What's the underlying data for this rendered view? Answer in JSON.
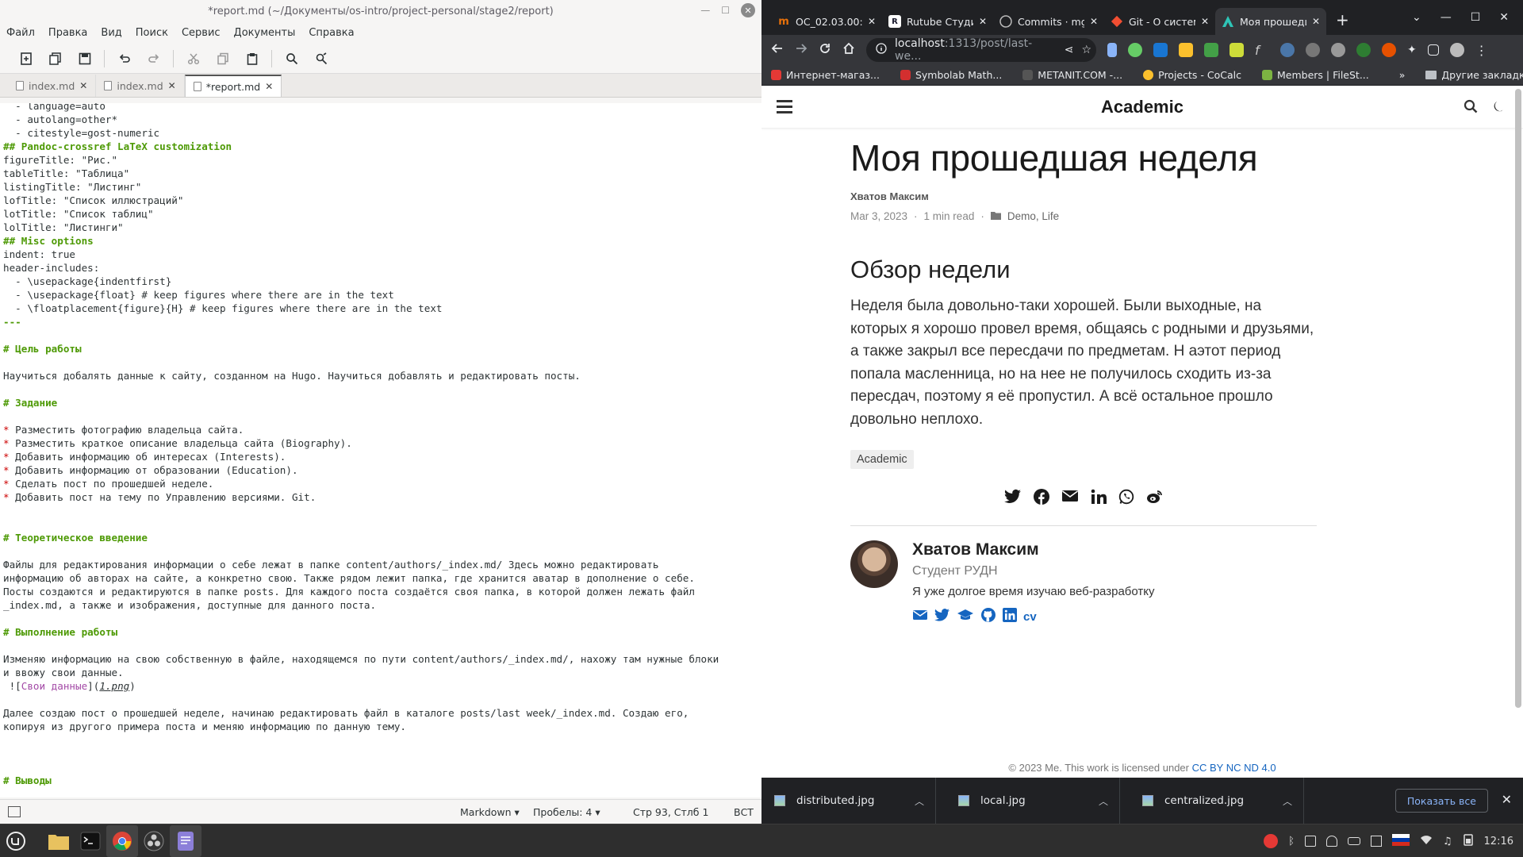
{
  "gedit": {
    "title": "*report.md (~/Документы/os-intro/project-personal/stage2/report)",
    "menu": [
      "Файл",
      "Правка",
      "Вид",
      "Поиск",
      "Сервис",
      "Документы",
      "Справка"
    ],
    "tabs": [
      {
        "label": "index.md",
        "active": false
      },
      {
        "label": "index.md",
        "active": false
      },
      {
        "label": "*report.md",
        "active": true
      }
    ],
    "status": {
      "language": "Markdown",
      "spaces": "Пробелы: 4",
      "position": "Стр 93, Стлб 1",
      "mode": "ВСТ"
    },
    "lines": [
      [
        {
          "t": "  - language=auto"
        }
      ],
      [
        {
          "t": "  - autolang=other*"
        }
      ],
      [
        {
          "t": "  - citestyle=gost-numeric"
        }
      ],
      [
        {
          "t": "## Pandoc-crossref LaTeX customization",
          "c": "c-h"
        }
      ],
      [
        {
          "t": "figureTitle: \"Рис.\""
        }
      ],
      [
        {
          "t": "tableTitle: \"Таблица\""
        }
      ],
      [
        {
          "t": "listingTitle: \"Листинг\""
        }
      ],
      [
        {
          "t": "lofTitle: \"Список иллюстраций\""
        }
      ],
      [
        {
          "t": "lotTitle: \"Список таблиц\""
        }
      ],
      [
        {
          "t": "lolTitle: \"Листинги\""
        }
      ],
      [
        {
          "t": "## Misc options",
          "c": "c-h"
        }
      ],
      [
        {
          "t": "indent: true"
        }
      ],
      [
        {
          "t": "header-includes:"
        }
      ],
      [
        {
          "t": "  - \\usepackage{indentfirst}"
        }
      ],
      [
        {
          "t": "  - \\usepackage{float} # keep figures where there are in the text"
        }
      ],
      [
        {
          "t": "  - \\floatplacement{figure}{H} # keep figures where there are in the text"
        }
      ],
      [
        {
          "t": "---",
          "c": "c-h"
        }
      ],
      [
        {
          "t": ""
        }
      ],
      [
        {
          "t": "# Цель работы",
          "c": "c-h"
        }
      ],
      [
        {
          "t": ""
        }
      ],
      [
        {
          "t": "Научиться добалять данные к сайту, созданном на Hugo. Научиться добавлять и редактировать посты."
        }
      ],
      [
        {
          "t": ""
        }
      ],
      [
        {
          "t": "# Задание",
          "c": "c-h"
        }
      ],
      [
        {
          "t": ""
        }
      ],
      [
        {
          "t": "*",
          "c": "c-b"
        },
        {
          "t": " Разместить фотографию владельца сайта."
        }
      ],
      [
        {
          "t": "*",
          "c": "c-b"
        },
        {
          "t": " Разместить краткое описание владельца сайта (Biography)."
        }
      ],
      [
        {
          "t": "*",
          "c": "c-b"
        },
        {
          "t": " Добавить информацию об интересах (Interests)."
        }
      ],
      [
        {
          "t": "*",
          "c": "c-b"
        },
        {
          "t": " Добавить информацию от образовании (Education)."
        }
      ],
      [
        {
          "t": "*",
          "c": "c-b"
        },
        {
          "t": " Сделать пост по прошедшей неделе."
        }
      ],
      [
        {
          "t": "*",
          "c": "c-b"
        },
        {
          "t": " Добавить пост на тему по Управлению версиями. Git."
        }
      ],
      [
        {
          "t": ""
        }
      ],
      [
        {
          "t": ""
        }
      ],
      [
        {
          "t": "# Теоретическое введение",
          "c": "c-h"
        }
      ],
      [
        {
          "t": ""
        }
      ],
      [
        {
          "t": "Файлы для редактирования информации о себе лежат в папке content/authors/_index.md/ Здесь можно редактировать"
        }
      ],
      [
        {
          "t": "информацию об авторах на сайте, а конкретно свою. Также рядом лежит папка, где хранится аватар в дополнение о себе."
        }
      ],
      [
        {
          "t": "Посты создаются и редактируются в папке posts. Для каждого поста создаётся своя папка, в которой должен лежать файл"
        }
      ],
      [
        {
          "t": "_index.md, а также и изображения, доступные для данного поста."
        }
      ],
      [
        {
          "t": ""
        }
      ],
      [
        {
          "t": "# Выполнение работы",
          "c": "c-h"
        }
      ],
      [
        {
          "t": ""
        }
      ],
      [
        {
          "t": "Изменяю информацию на свою собственную в файле, находящемся по пути content/authors/_index.md/, нахожу там нужные блоки"
        }
      ],
      [
        {
          "t": "и ввожу свои данные."
        }
      ],
      [
        {
          "t": " !["
        },
        {
          "t": "Свои данные",
          "c": "c-l"
        },
        {
          "t": "]("
        },
        {
          "t": "1.png",
          "c": "c-i"
        },
        {
          "t": ")"
        }
      ],
      [
        {
          "t": ""
        }
      ],
      [
        {
          "t": "Далее создаю пост о прошедшей неделе, начинаю редактировать файл в каталоге posts/last week/_index.md. Создаю его,"
        }
      ],
      [
        {
          "t": "копируя из другого примера поста и меняю информацию по данную тему."
        }
      ],
      [
        {
          "t": ""
        }
      ],
      [
        {
          "t": ""
        }
      ],
      [
        {
          "t": ""
        }
      ],
      [
        {
          "t": "# Выводы",
          "c": "c-h"
        }
      ]
    ]
  },
  "chrome": {
    "tabs": [
      {
        "label": "ОС_02.03.00:5",
        "favicon": "m",
        "color": "#e8710a",
        "active": false
      },
      {
        "label": "Rutube Студи",
        "favicon": "R",
        "color": "#1a1a2e",
        "active": false
      },
      {
        "label": "Commits · mg",
        "favicon": "github-icon",
        "color": "#24292f",
        "active": false
      },
      {
        "label": "Git - О систем",
        "favicon": "git-icon",
        "color": "#f14e32",
        "active": false
      },
      {
        "label": "Моя прошедш",
        "favicon": "academic-icon",
        "color": "#2ec4b6",
        "active": true
      }
    ],
    "url_host": "localhost",
    "url_rest": ":1313/post/last-we...",
    "bookmarks": [
      {
        "label": "Интернет-магаз...",
        "color": "#e53935"
      },
      {
        "label": "Symbolab Math...",
        "color": "#d32f2f"
      },
      {
        "label": "METANIT.COM -...",
        "color": "#555"
      },
      {
        "label": "Projects - CoCalc",
        "color": "#fbc02d"
      },
      {
        "label": "Members | FileSt...",
        "color": "#7cb342"
      }
    ],
    "bookmarks_more": "»",
    "other_bookmarks": "Другие закладки",
    "downloads": [
      "distributed.jpg",
      "local.jpg",
      "centralized.jpg"
    ],
    "show_all": "Показать все"
  },
  "page": {
    "brand": "Academic",
    "title": "Моя прошедшая неделя",
    "author": "Хватов Максим",
    "date": "Mar 3, 2023",
    "read_time": "1 min read",
    "categories": "Demo, Life",
    "section": "Обзор недели",
    "body": "Неделя была довольно-таки хорошей. Были выходные, на которых я хорошо провел время, общаясь с родными и друзьями, а также закрыл все пересдачи по предметам. Н аэтот период попала масленница, но на нее не получилось сходить из-за пересдач, поэтому я её пропустил. А всё остальное прошло довольно неплохо.",
    "tag": "Academic",
    "share_icons": [
      "twitter-icon",
      "facebook-icon",
      "email-icon",
      "linkedin-icon",
      "whatsapp-icon",
      "weibo-icon"
    ],
    "author_box": {
      "name": "Хватов Максим",
      "role": "Студент РУДН",
      "bio": "Я уже долгое время изучаю веб-разработку",
      "cv": "cv"
    },
    "footer_text": "© 2023 Me. This work is licensed under ",
    "footer_license": "CC BY NC ND 4.0"
  },
  "taskbar": {
    "time": "12:16"
  }
}
